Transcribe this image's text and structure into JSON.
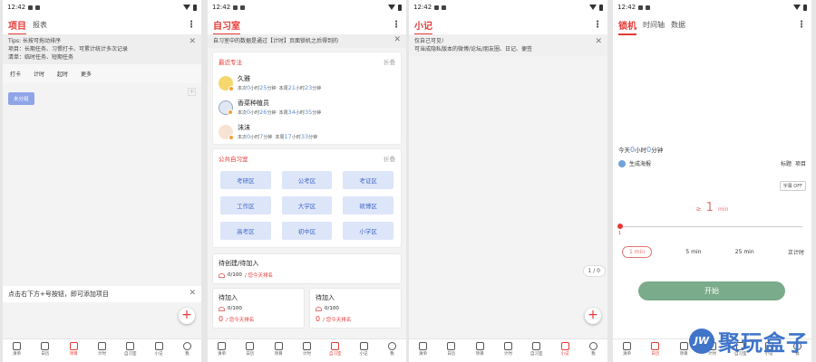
{
  "status": {
    "time": "12:42"
  },
  "nav": [
    {
      "label": "清单",
      "icon": "list-icon"
    },
    {
      "label": "日历",
      "icon": "calendar-icon"
    },
    {
      "label": "项目",
      "icon": "project-icon"
    },
    {
      "label": "计时",
      "icon": "timer-icon"
    },
    {
      "label": "自习室",
      "icon": "study-room-icon"
    },
    {
      "label": "小记",
      "icon": "note-icon"
    },
    {
      "label": "我",
      "icon": "profile-icon"
    }
  ],
  "screen1": {
    "title": "项目",
    "tab2": "报表",
    "tip_lines": [
      "Tips: 长按可拖动排序",
      "项目：长期任务、习惯打卡、可累计统计多次记录",
      "清单：临时任务、短期任务"
    ],
    "tabs": [
      "打卡",
      "计时",
      "起时",
      "更多"
    ],
    "chip": "未分组",
    "hint": "点击右下方+号按钮，即可添加项目",
    "nav_active": 2
  },
  "screen2": {
    "title": "自习室",
    "tip": "自习室中的数据是通过【计时】页面锁机之后得到的",
    "recent": {
      "title": "最近专注",
      "fold": "折叠",
      "users": [
        {
          "name": "久雅",
          "this_h": "0",
          "this_m": "25",
          "week_h": "21",
          "week_m": "23"
        },
        {
          "name": "香菜种植员",
          "this_h": "0",
          "this_m": "26",
          "week_h": "34",
          "week_m": "35"
        },
        {
          "name": "沫沫",
          "this_h": "0",
          "this_m": "7",
          "week_h": "17",
          "week_m": "33"
        }
      ],
      "this_label": "本次",
      "week_label": "本周",
      "h_unit": "小时",
      "m_unit": "分钟"
    },
    "public": {
      "title": "公共自习室",
      "fold": "折叠",
      "rooms": [
        "考研区",
        "公考区",
        "考证区",
        "工作区",
        "大学区",
        "硕博区",
        "高考区",
        "初中区",
        "小学区"
      ]
    },
    "pending": {
      "title": "待创建/待加入",
      "count": "0/100",
      "rank": "/ 您今天排名"
    },
    "join1": {
      "title": "待加入",
      "count": "0/100",
      "rank_pre": "0",
      "rank": "/ 您今天排名"
    },
    "join2": {
      "title": "待加入",
      "count": "0/100",
      "rank_pre": "0",
      "rank": "/ 您今天排名"
    },
    "nav_active": 4
  },
  "screen3": {
    "title": "小记",
    "tip_lines": [
      "仅自己可见!",
      "可当成隐私版本的微博/论坛/朋友圈、日记、便签"
    ],
    "page": "1 / 0",
    "nav_active": 5
  },
  "screen4": {
    "title": "锁机",
    "tab2": "时间轴",
    "tab3": "数据",
    "today_pre": "今天",
    "today_h": "0",
    "today_h_unit": "小时",
    "today_m": "0",
    "today_m_unit": "分钟",
    "poster": "生成海报",
    "btn_tag": "标题",
    "btn_item": "项目",
    "toggle": "字幕 OFF",
    "duration_pre": "≥",
    "duration": "1",
    "duration_unit": "min",
    "slider_min": "1",
    "presets": [
      "1 min",
      "5 min",
      "25 min",
      "正计时"
    ],
    "start": "开始",
    "nav_active": 1,
    "accent": "#7aab8a"
  },
  "watermark": {
    "logo": "JW",
    "text": "聚玩盒子"
  }
}
